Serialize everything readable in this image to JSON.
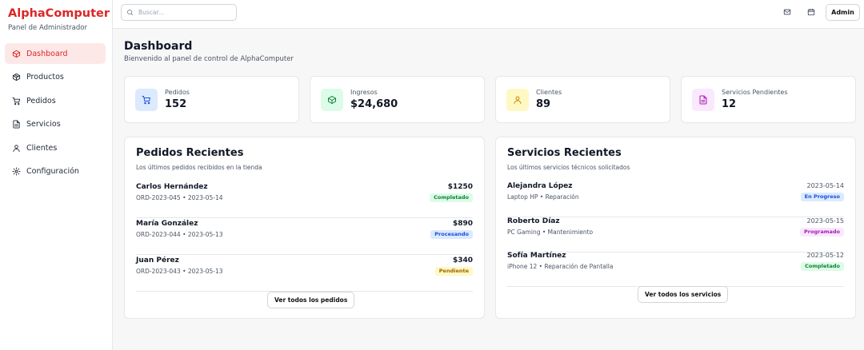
{
  "brand": {
    "name": "AlphaComputer",
    "subtitle": "Panel de Administrador"
  },
  "sidebar": {
    "items": [
      {
        "label": "Dashboard",
        "icon": "box-icon",
        "active": true
      },
      {
        "label": "Productos",
        "icon": "package-icon",
        "active": false
      },
      {
        "label": "Pedidos",
        "icon": "cart-icon",
        "active": false
      },
      {
        "label": "Servicios",
        "icon": "document-icon",
        "active": false
      },
      {
        "label": "Clientes",
        "icon": "user-icon",
        "active": false
      },
      {
        "label": "Configuración",
        "icon": "gear-icon",
        "active": false
      }
    ]
  },
  "topbar": {
    "search_placeholder": "Buscar...",
    "admin_label": "Admin",
    "icons": [
      "mail-icon",
      "calendar-icon"
    ]
  },
  "page": {
    "title": "Dashboard",
    "subtitle": "Bienvenido al panel de control de AlphaComputer"
  },
  "stats": [
    {
      "label": "Pedidos",
      "value": "152",
      "icon": "cart-icon",
      "bg": "#dbeafe",
      "color": "#1d4ed8"
    },
    {
      "label": "Ingresos",
      "value": "$24,680",
      "icon": "package-icon",
      "bg": "#dcfce7",
      "color": "#15803d"
    },
    {
      "label": "Clientes",
      "value": "89",
      "icon": "user-icon",
      "bg": "#fef9c3",
      "color": "#ca8a04"
    },
    {
      "label": "Servicios Pendientes",
      "value": "12",
      "icon": "document-icon",
      "bg": "#fae8ff",
      "color": "#a21caf"
    }
  ],
  "orders": {
    "title": "Pedidos Recientes",
    "subtitle": "Los últimos pedidos recibidos en la tienda",
    "rows": [
      {
        "name": "Carlos Hernández",
        "meta": "ORD-2023-045 • 2023-05-14",
        "amount": "$1250",
        "status": "Completado",
        "status_color": "green"
      },
      {
        "name": "María González",
        "meta": "ORD-2023-044 • 2023-05-13",
        "amount": "$890",
        "status": "Procesando",
        "status_color": "blue"
      },
      {
        "name": "Juan Pérez",
        "meta": "ORD-2023-043 • 2023-05-13",
        "amount": "$340",
        "status": "Pendiente",
        "status_color": "yellow"
      }
    ],
    "button": "Ver todos los pedidos"
  },
  "services": {
    "title": "Servicios Recientes",
    "subtitle": "Los últimos servicios técnicos solicitados",
    "rows": [
      {
        "name": "Alejandra López",
        "meta": "Laptop HP • Reparación",
        "date": "2023-05-14",
        "status": "En Progreso",
        "status_color": "blue"
      },
      {
        "name": "Roberto Díaz",
        "meta": "PC Gaming • Mantenimiento",
        "date": "2023-05-15",
        "status": "Programado",
        "status_color": "purple"
      },
      {
        "name": "Sofía Martínez",
        "meta": "iPhone 12 • Reparación de Pantalla",
        "date": "2023-05-12",
        "status": "Completado",
        "status_color": "green"
      }
    ],
    "button": "Ver todos los servicios"
  }
}
